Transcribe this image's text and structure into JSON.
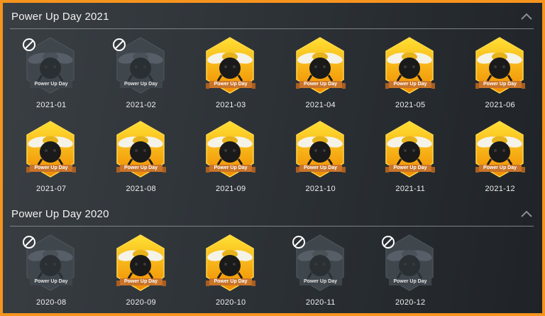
{
  "colors": {
    "frame": "#f7941d",
    "hex_active_light": "#ffe033",
    "hex_active_dark": "#f08a00",
    "hex_inactive": "#3f464c",
    "ribbon_active": "#c8742a",
    "text": "#f0f0f0"
  },
  "icons": {
    "collapse": "chevron-up-icon",
    "locked": "no-entry-icon",
    "badge": "bee-icon"
  },
  "sections": [
    {
      "title": "Power Up Day 2021",
      "badges": [
        {
          "label": "2021-01",
          "ribbon": "Power Up Day",
          "earned": false
        },
        {
          "label": "2021-02",
          "ribbon": "Power Up Day",
          "earned": false
        },
        {
          "label": "2021-03",
          "ribbon": "Power Up Day",
          "earned": true
        },
        {
          "label": "2021-04",
          "ribbon": "Power Up Day",
          "earned": true
        },
        {
          "label": "2021-05",
          "ribbon": "Power Up Day",
          "earned": true
        },
        {
          "label": "2021-06",
          "ribbon": "Power Up Day",
          "earned": true
        },
        {
          "label": "2021-07",
          "ribbon": "Power Up Day",
          "earned": true
        },
        {
          "label": "2021-08",
          "ribbon": "Power Up Day",
          "earned": true
        },
        {
          "label": "2021-09",
          "ribbon": "Power Up Day",
          "earned": true
        },
        {
          "label": "2021-10",
          "ribbon": "Power Up Day",
          "earned": true
        },
        {
          "label": "2021-11",
          "ribbon": "Power Up Day",
          "earned": true
        },
        {
          "label": "2021-12",
          "ribbon": "Power Up Day",
          "earned": true
        }
      ]
    },
    {
      "title": "Power Up Day 2020",
      "badges": [
        {
          "label": "2020-08",
          "ribbon": "Power Up Day",
          "earned": false
        },
        {
          "label": "2020-09",
          "ribbon": "Power Up Day",
          "earned": true
        },
        {
          "label": "2020-10",
          "ribbon": "Power Up Day",
          "earned": true
        },
        {
          "label": "2020-11",
          "ribbon": "Power Up Day",
          "earned": false
        },
        {
          "label": "2020-12",
          "ribbon": "Power Up Day",
          "earned": false
        }
      ]
    }
  ]
}
